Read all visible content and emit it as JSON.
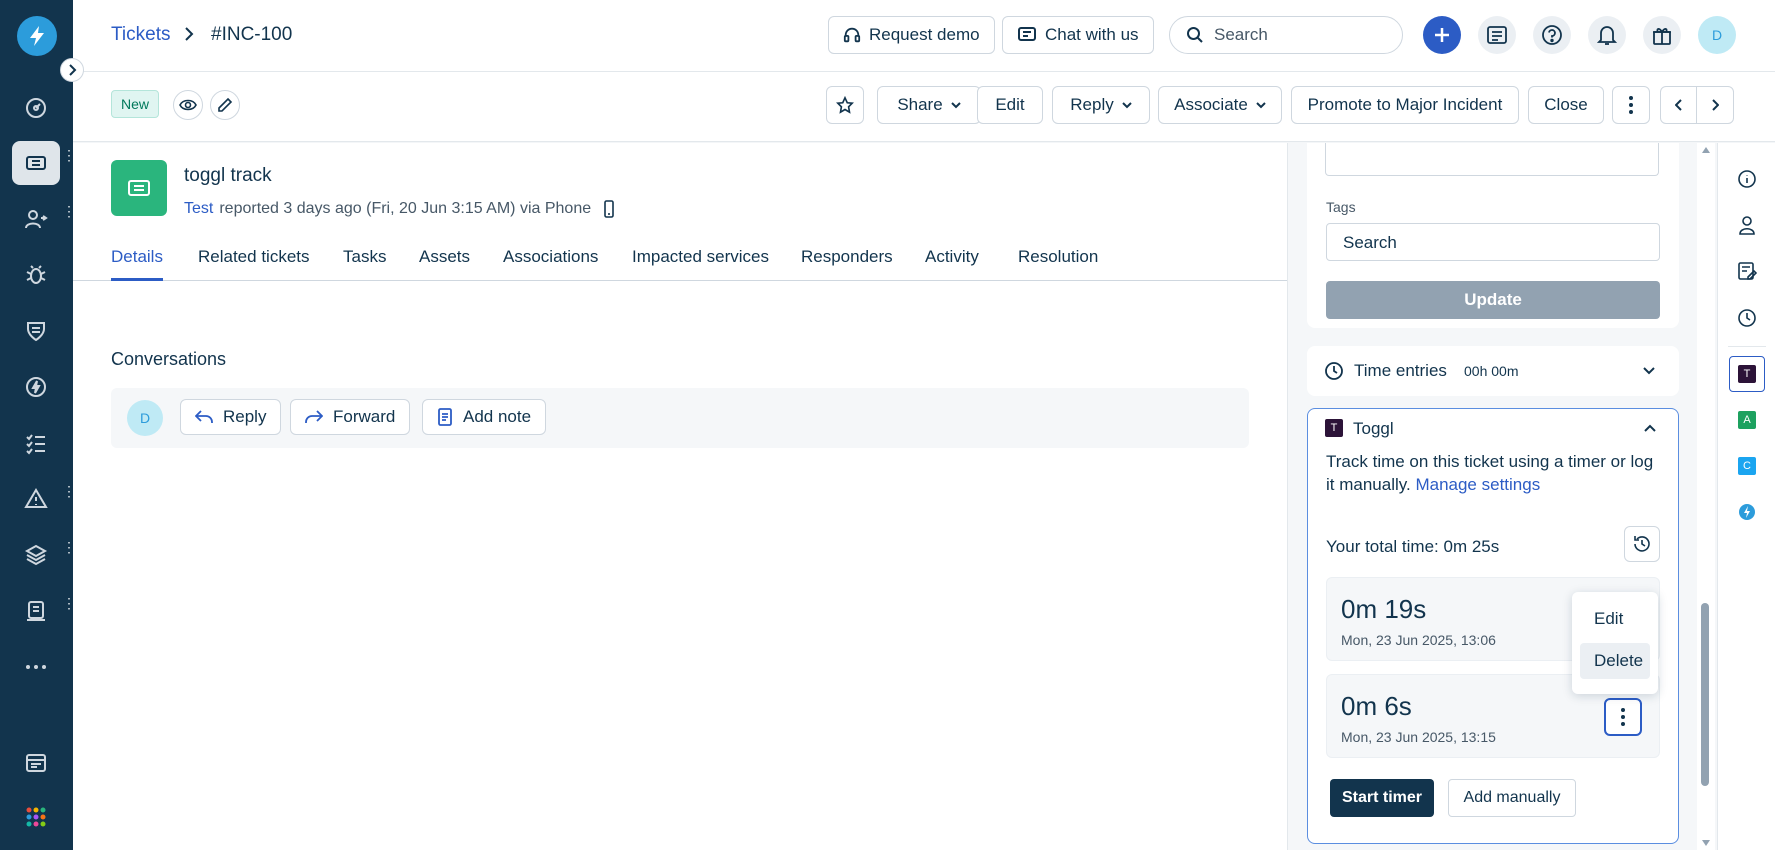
{
  "header": {
    "breadcrumb_root": "Tickets",
    "breadcrumb_current": "#INC-100",
    "request_demo": "Request demo",
    "chat_with_us": "Chat with us",
    "search_placeholder": "Search",
    "avatar_initial": "D"
  },
  "actionbar": {
    "status_badge": "New",
    "share": "Share",
    "edit": "Edit",
    "reply": "Reply",
    "associate": "Associate",
    "promote": "Promote to Major Incident",
    "close": "Close"
  },
  "ticket": {
    "title": "toggl track",
    "requester": "Test",
    "meta": "reported 3 days ago (Fri, 20 Jun 3:15 AM) via Phone"
  },
  "tabs": [
    "Details",
    "Related tickets",
    "Tasks",
    "Assets",
    "Associations",
    "Impacted services",
    "Responders",
    "Activity",
    "Resolution"
  ],
  "conversations": {
    "title": "Conversations",
    "avatar_initial": "D",
    "reply": "Reply",
    "forward": "Forward",
    "add_note": "Add note"
  },
  "properties": {
    "tags_label": "Tags",
    "tags_placeholder": "Search",
    "update": "Update"
  },
  "time_entries": {
    "label": "Time entries",
    "total": "00h 00m"
  },
  "toggl": {
    "app_initial": "T",
    "title": "Toggl",
    "description": "Track time on this ticket using a timer or log it manually.",
    "manage_settings": "Manage settings",
    "total_time": "Your total time: 0m 25s",
    "entries": [
      {
        "duration": "0m 19s",
        "date": "Mon, 23 Jun 2025, 13:06"
      },
      {
        "duration": "0m 6s",
        "date": "Mon, 23 Jun 2025, 13:15"
      }
    ],
    "menu": {
      "edit": "Edit",
      "delete": "Delete"
    },
    "start_timer": "Start timer",
    "add_manually": "Add manually"
  },
  "apps_strip": [
    {
      "letter": "T",
      "color": "#2c1338"
    },
    {
      "letter": "A",
      "color": "#1da15f"
    },
    {
      "letter": "C",
      "color": "#1ba5f0"
    }
  ],
  "colors": {
    "sidebar": "#12344d",
    "accent": "#2c5cc5",
    "ticket_icon": "#2ab57d"
  }
}
